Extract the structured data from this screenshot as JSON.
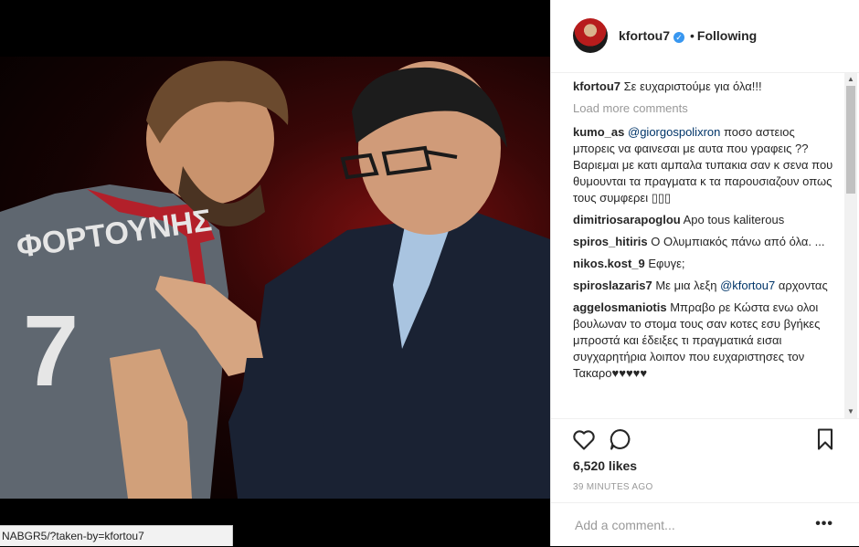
{
  "viewer": {
    "status_url": "NABGR5/?taken-by=kfortou7"
  },
  "photo": {
    "jersey_name": "ΦΟΡΤΟΥΝΗΣ",
    "jersey_number": "7"
  },
  "post": {
    "author": "kfortou7",
    "verified_icon": "verified-badge-icon",
    "separator": "•",
    "follow_state": "Following",
    "caption": {
      "user": "kfortou7",
      "text": "Σε ευχαριστούμε για όλα!!!"
    },
    "load_more": "Load more comments",
    "comments": [
      {
        "user": "kumo_as",
        "mention": "@giorgospolixron",
        "text": "ποσο αστειος μπορεις να φαινεσαι με αυτα που γραφεις ?? Βαριεμαι με κατι αμπαλα τυπακια σαν κ σενα που θυμουνται τα πραγματα κ τα παρουσιαζουν οπως τους συμφερει ▯▯▯"
      },
      {
        "user": "dimitriosarapoglou",
        "mention": "",
        "text": "Apo tous kaliterous"
      },
      {
        "user": "spiros_hitiris",
        "mention": "",
        "text": "Ο Ολυμπιακός πάνω από όλα. ..."
      },
      {
        "user": "nikos.kost_9",
        "mention": "",
        "text": "Εφυγε;"
      },
      {
        "user": "spiroslazaris7",
        "mention": "",
        "text": "Με μια λεξη",
        "mention_after": "@kfortou7",
        "text_after": "αρχοντας"
      },
      {
        "user": "aggelosmaniotis",
        "mention": "",
        "text": "Μπραβο ρε Κώστα ενω ολοι βουλωναν το στομα τους σαν κοτες εσυ βγήκες μπροστά και έδειξες τι πραγματικά εισαι συγχαρητήρια λοιπον που ευχαριστησες τον Τακαρο♥♥♥♥♥"
      }
    ],
    "likes": "6,520 likes",
    "time": "39 MINUTES AGO",
    "comment_placeholder": "Add a comment...",
    "more_label": "•••",
    "icons": [
      "heart-icon",
      "comment-icon",
      "bookmark-icon"
    ]
  }
}
